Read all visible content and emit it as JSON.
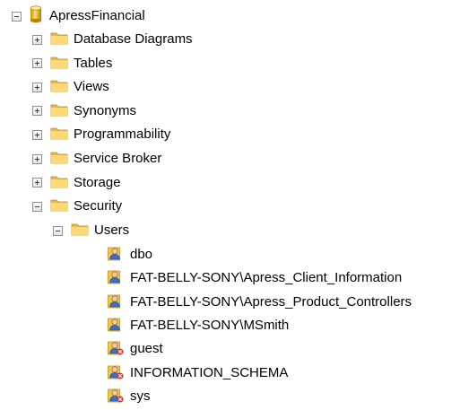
{
  "tree": {
    "root": {
      "label": "ApressFinancial",
      "icon": "database-icon",
      "expanded": true
    },
    "folders": [
      {
        "label": "Database Diagrams",
        "expanded": false,
        "icon": "folder-icon"
      },
      {
        "label": "Tables",
        "expanded": false,
        "icon": "folder-icon"
      },
      {
        "label": "Views",
        "expanded": false,
        "icon": "folder-icon"
      },
      {
        "label": "Synonyms",
        "expanded": false,
        "icon": "folder-icon"
      },
      {
        "label": "Programmability",
        "expanded": false,
        "icon": "folder-icon"
      },
      {
        "label": "Service Broker",
        "expanded": false,
        "icon": "folder-icon"
      },
      {
        "label": "Storage",
        "expanded": false,
        "icon": "folder-icon"
      },
      {
        "label": "Security",
        "expanded": true,
        "icon": "folder-icon"
      }
    ],
    "users_folder": {
      "label": "Users",
      "expanded": true,
      "icon": "folder-icon"
    },
    "users": [
      {
        "label": "dbo",
        "icon": "user-icon"
      },
      {
        "label": "FAT-BELLY-SONY\\Apress_Client_Information",
        "icon": "user-icon"
      },
      {
        "label": "FAT-BELLY-SONY\\Apress_Product_Controllers",
        "icon": "user-icon"
      },
      {
        "label": "FAT-BELLY-SONY\\MSmith",
        "icon": "user-icon"
      },
      {
        "label": "guest",
        "icon": "user-disabled-icon"
      },
      {
        "label": "INFORMATION_SCHEMA",
        "icon": "user-disabled-icon"
      },
      {
        "label": "sys",
        "icon": "user-disabled-icon"
      }
    ]
  }
}
